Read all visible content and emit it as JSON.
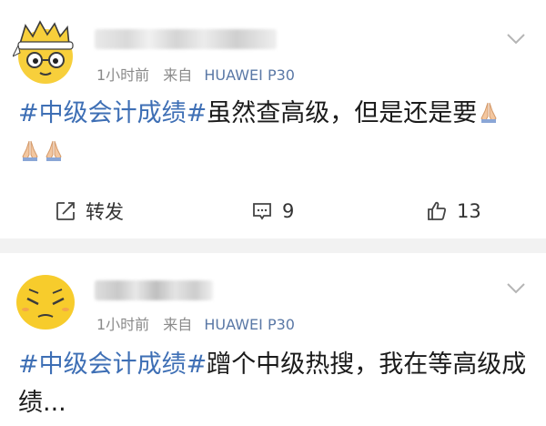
{
  "posts": [
    {
      "meta_time": "1小时前",
      "meta_source": "来自",
      "meta_device": "HUAWEI P30",
      "hashtag": "#中级会计成绩#",
      "text": "虽然查高级，但是还是要",
      "actions": {
        "repost_label": "转发",
        "comment_count": "9",
        "like_count": "13"
      }
    },
    {
      "meta_time": "1小时前",
      "meta_source": "来自",
      "meta_device": "HUAWEI P30",
      "hashtag": "#中级会计成绩#",
      "text": "蹭个中级热搜，我在等高级成绩..."
    }
  ],
  "colors": {
    "hashtag": "#3e6fb5",
    "device": "#5a78a6",
    "meta": "#8a8a8a",
    "divider": "#f2f2f2"
  },
  "icons": [
    "crown-emoji-avatar",
    "pleading-emoji-avatar",
    "chevron-down-icon",
    "pray-emoji",
    "repost-icon",
    "comment-icon",
    "like-icon"
  ]
}
